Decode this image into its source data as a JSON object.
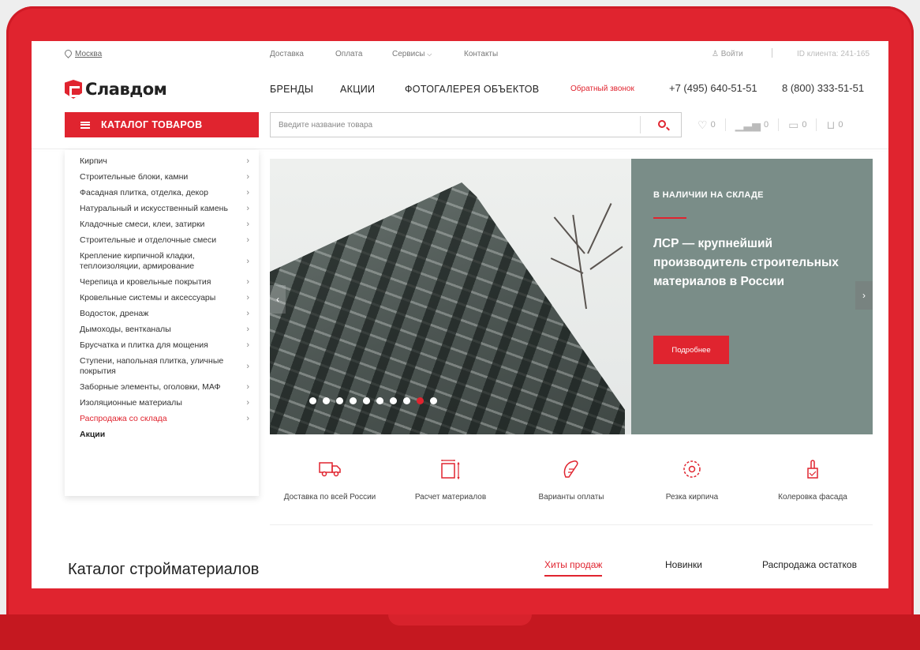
{
  "topbar": {
    "city": "Москва",
    "links": [
      "Доставка",
      "Оплата",
      "Сервисы",
      "Контакты"
    ],
    "login": "Войти",
    "client_id": "ID клиента: 241-165"
  },
  "header": {
    "logo": "Славдом",
    "nav": [
      "БРЕНДЫ",
      "АКЦИИ",
      "ФОТОГАЛЕРЕЯ ОБЪЕКТОВ"
    ],
    "callback": "Обратный звонок",
    "phones": [
      "+7 (495) 640-51-51",
      "8 (800) 333-51-51"
    ]
  },
  "catalog_button": "КАТАЛОГ ТОВАРОВ",
  "search": {
    "placeholder": "Введите название товара",
    "icon": "search-icon"
  },
  "counters": [
    {
      "icon": "heart-icon",
      "count": "0"
    },
    {
      "icon": "compare-icon",
      "count": "0"
    },
    {
      "icon": "wallet-icon",
      "count": "0"
    },
    {
      "icon": "cart-icon",
      "count": "0"
    }
  ],
  "sidebar": {
    "items": [
      "Кирпич",
      "Строительные блоки, камни",
      "Фасадная плитка, отделка, декор",
      "Натуральный и искусственный камень",
      "Кладочные смеси, клеи, затирки",
      "Строительные и отделочные смеси",
      "Крепление кирпичной кладки, теплоизоляции, армирование",
      "Черепица и кровельные покрытия",
      "Кровельные системы и аксессуары",
      "Водосток, дренаж",
      "Дымоходы, вентканалы",
      "Брусчатка и плитка для мощения",
      "Ступени, напольная плитка, уличные покрытия",
      "Заборные элементы, оголовки, МАФ",
      "Изоляционные материалы",
      "Распродажа со склада",
      "Акции"
    ]
  },
  "slider": {
    "kicker": "В НАЛИЧИИ НА СКЛАДЕ",
    "headline": "ЛСР — крупнейший производитель строительных материалов в России",
    "button": "Подробнее",
    "dot_count": 10,
    "active_dot": 8
  },
  "features": [
    {
      "icon": "truck-icon",
      "label": "Доставка по всей России"
    },
    {
      "icon": "calculator-icon",
      "label": "Расчет материалов"
    },
    {
      "icon": "wallet-icon",
      "label": "Варианты оплаты"
    },
    {
      "icon": "saw-icon",
      "label": "Резка кирпича"
    },
    {
      "icon": "paint-icon",
      "label": "Колеровка фасада"
    }
  ],
  "catalog_section": {
    "title": "Каталог стройматериалов",
    "tabs": [
      "Хиты продаж",
      "Новинки",
      "Распродажа остатков"
    ],
    "active_tab": 0
  },
  "colors": {
    "accent": "#e0242f",
    "panel": "#7a8d88"
  }
}
